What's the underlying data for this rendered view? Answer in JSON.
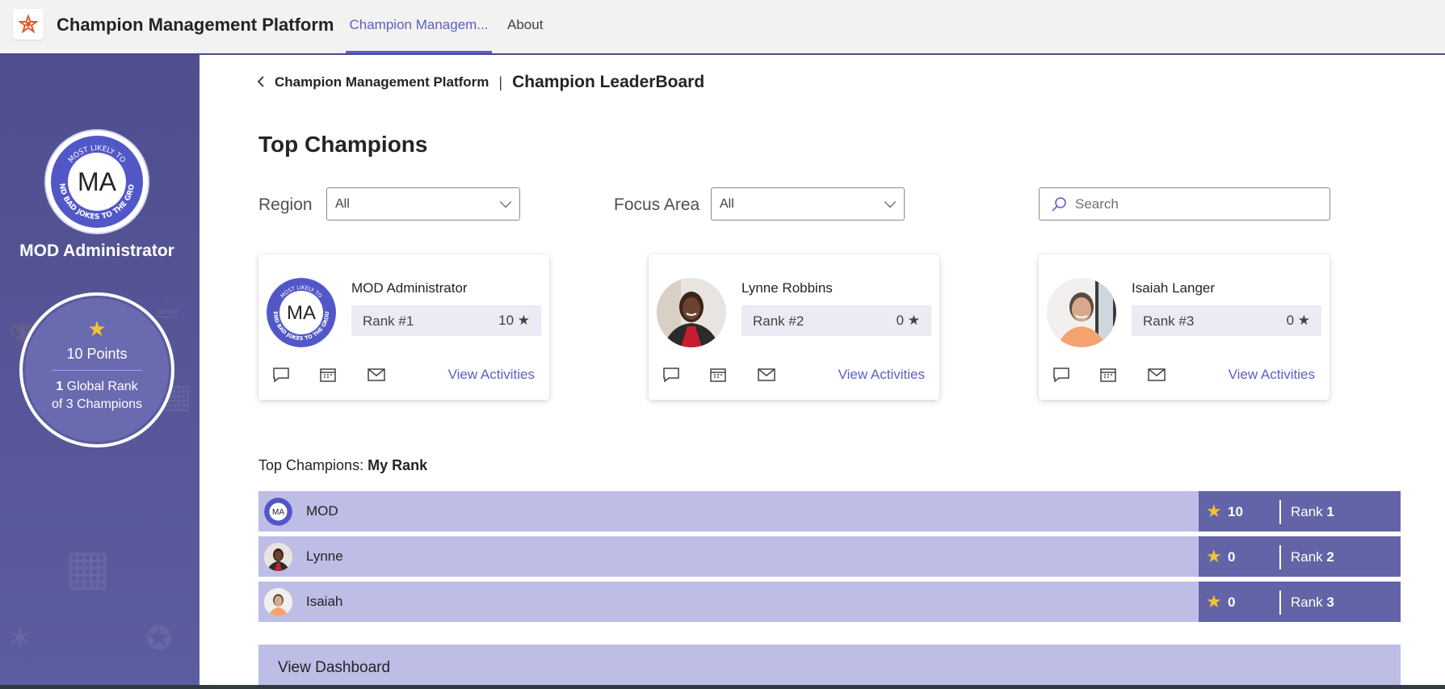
{
  "topbar": {
    "app_title": "Champion Management Platform",
    "tabs": [
      {
        "label": "Champion Managem...",
        "active": true
      },
      {
        "label": "About",
        "active": false
      }
    ]
  },
  "sidebar": {
    "user_initials": "MA",
    "badge_text_top": "MOST LIKELY TO",
    "badge_text_bottom": "SEND BAD JOKES TO THE GROUP",
    "user_name": "MOD Administrator",
    "points_label": "10 Points",
    "global_rank_number": "1",
    "global_rank_label": " Global Rank",
    "rank_of_label": "of 3 Champions"
  },
  "breadcrumb": {
    "parent": "Champion Management Platform",
    "separator": "|",
    "current": "Champion LeaderBoard"
  },
  "main": {
    "title": "Top Champions",
    "region_label": "Region",
    "region_value": "All",
    "focus_label": "Focus Area",
    "focus_value": "All",
    "search_placeholder": "Search"
  },
  "cards": [
    {
      "name": "MOD Administrator",
      "rank": "Rank #1",
      "points": "10 ★",
      "view": "View Activities"
    },
    {
      "name": "Lynne Robbins",
      "rank": "Rank #2",
      "points": "0 ★",
      "view": "View Activities"
    },
    {
      "name": "Isaiah Langer",
      "rank": "Rank #3",
      "points": "0 ★",
      "view": "View Activities"
    }
  ],
  "my_rank": {
    "title_prefix": "Top Champions: ",
    "title_bold": "My Rank",
    "rows": [
      {
        "name": "MOD",
        "points": "10",
        "rank_label": "Rank ",
        "rank": "1"
      },
      {
        "name": "Lynne",
        "points": "0",
        "rank_label": "Rank ",
        "rank": "2"
      },
      {
        "name": "Isaiah",
        "points": "0",
        "rank_label": "Rank ",
        "rank": "3"
      }
    ]
  },
  "dashboard_label": "View Dashboard",
  "colors": {
    "accent": "#5b5fc7",
    "sidebar": "#55559a",
    "row_bg": "#bdbde6",
    "stats_bg": "#6264a7",
    "star": "#f2c335"
  }
}
